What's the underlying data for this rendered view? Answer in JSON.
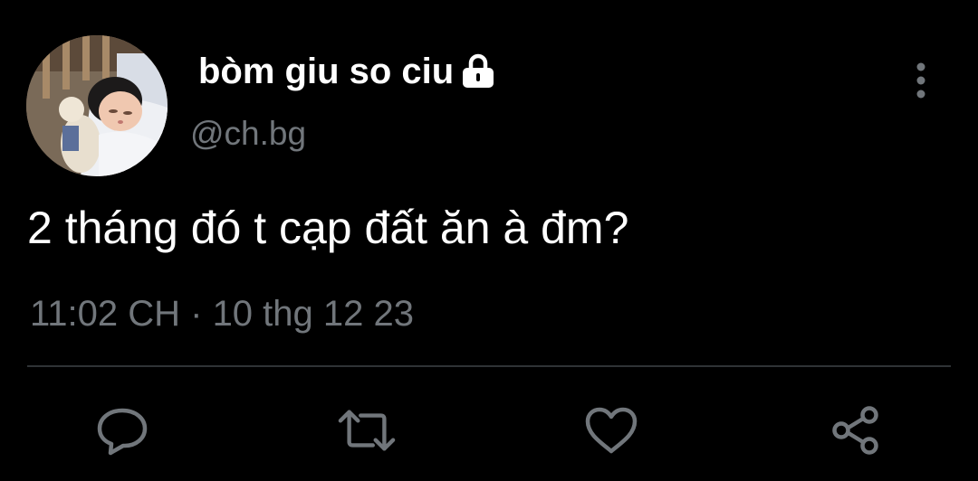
{
  "tweet": {
    "display_name": "bòm giu so ciu",
    "handle": "@ch.bg",
    "text": "2 tháng đó t cạp đất ăn à đm?",
    "timestamp": "11:02 CH · 10 thg 12 23",
    "protected_icon": "lock-icon"
  },
  "actions": {
    "reply_icon": "reply-icon",
    "retweet_icon": "retweet-icon",
    "like_icon": "heart-icon",
    "share_icon": "share-icon",
    "more_icon": "more-vertical-icon"
  },
  "colors": {
    "background": "#000000",
    "primary_text": "#ffffff",
    "secondary_text": "#71767b",
    "icon": "#71767b",
    "divider": "#2f3336"
  }
}
